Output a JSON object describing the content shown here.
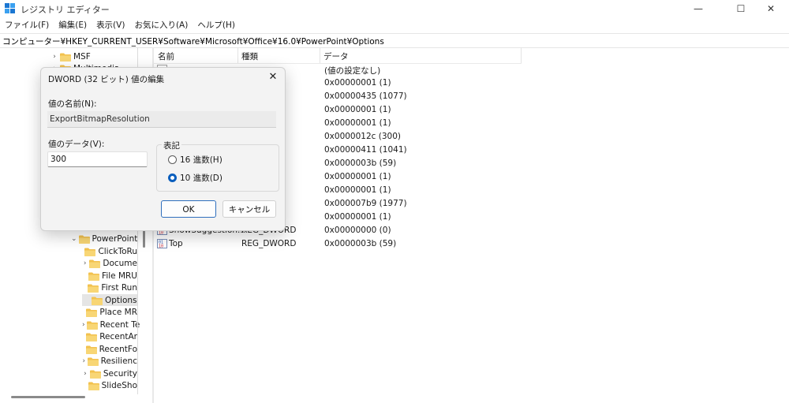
{
  "window": {
    "title": "レジストリ エディター",
    "minimize": "—",
    "maximize": "☐",
    "close": "✕"
  },
  "menu": [
    "ファイル(F)",
    "編集(E)",
    "表示(V)",
    "お気に入り(A)",
    "ヘルプ(H)"
  ],
  "address": "コンピューター¥HKEY_CURRENT_USER¥Software¥Microsoft¥Office¥16.0¥PowerPoint¥Options",
  "tree": [
    {
      "label": "MSF",
      "expander": "›",
      "selected": false
    },
    {
      "label": "Multimedia",
      "expander": "›",
      "selected": false
    },
    {
      "label": "PowerPoint",
      "expander": "⌄",
      "selected": false
    },
    {
      "label": "ClickToRu",
      "expander": "",
      "selected": false
    },
    {
      "label": "Docume",
      "expander": "›",
      "selected": false
    },
    {
      "label": "File MRU",
      "expander": "",
      "selected": false
    },
    {
      "label": "First Run",
      "expander": "",
      "selected": false
    },
    {
      "label": "Options",
      "expander": "",
      "selected": true
    },
    {
      "label": "Place MR",
      "expander": "",
      "selected": false
    },
    {
      "label": "Recent Te",
      "expander": "›",
      "selected": false
    },
    {
      "label": "RecentAr",
      "expander": "",
      "selected": false
    },
    {
      "label": "RecentFo",
      "expander": "",
      "selected": false
    },
    {
      "label": "Resilienc",
      "expander": "›",
      "selected": false
    },
    {
      "label": "Security",
      "expander": "›",
      "selected": false
    },
    {
      "label": "SlideSho",
      "expander": "",
      "selected": false
    }
  ],
  "list": {
    "headers": {
      "name": "名前",
      "type": "種類",
      "data": "データ"
    },
    "rows": [
      {
        "name": "",
        "type": "",
        "data": "(値の設定なし)"
      },
      {
        "name": "",
        "type": "",
        "data": "0x00000001 (1)"
      },
      {
        "name": "",
        "type": "",
        "data": "0x00000435 (1077)"
      },
      {
        "name": "",
        "type": "",
        "data": "0x00000001 (1)"
      },
      {
        "name": "",
        "type": "",
        "data": "0x00000001 (1)"
      },
      {
        "name": "",
        "type": "",
        "data": "0x0000012c (300)"
      },
      {
        "name": "",
        "type": "",
        "data": "0x00000411 (1041)"
      },
      {
        "name": "",
        "type": "",
        "data": "0x0000003b (59)"
      },
      {
        "name": "",
        "type": "",
        "data": "0x00000001 (1)"
      },
      {
        "name": "",
        "type": "",
        "data": "0x00000001 (1)"
      },
      {
        "name": "",
        "type": "",
        "data": "0x000007b9 (1977)"
      },
      {
        "name": "",
        "type": "",
        "data": "0x00000001 (1)"
      },
      {
        "name": "ShowSuggestion...",
        "type": "REG_DWORD",
        "data": "0x00000000 (0)"
      },
      {
        "name": "Top",
        "type": "REG_DWORD",
        "data": "0x0000003b (59)"
      }
    ]
  },
  "dialog": {
    "title": "DWORD (32 ビット) 値の編集",
    "close": "✕",
    "name_label": "値の名前(N):",
    "name_value": "ExportBitmapResolution",
    "data_label": "値のデータ(V):",
    "data_value": "300",
    "base_label": "表記",
    "hex_label": "16 進数(H)",
    "dec_label": "10 進数(D)",
    "ok": "OK",
    "cancel": "キャンセル"
  },
  "colors": {
    "accent": "#0a5ebd",
    "folder": "#f2c14e"
  }
}
